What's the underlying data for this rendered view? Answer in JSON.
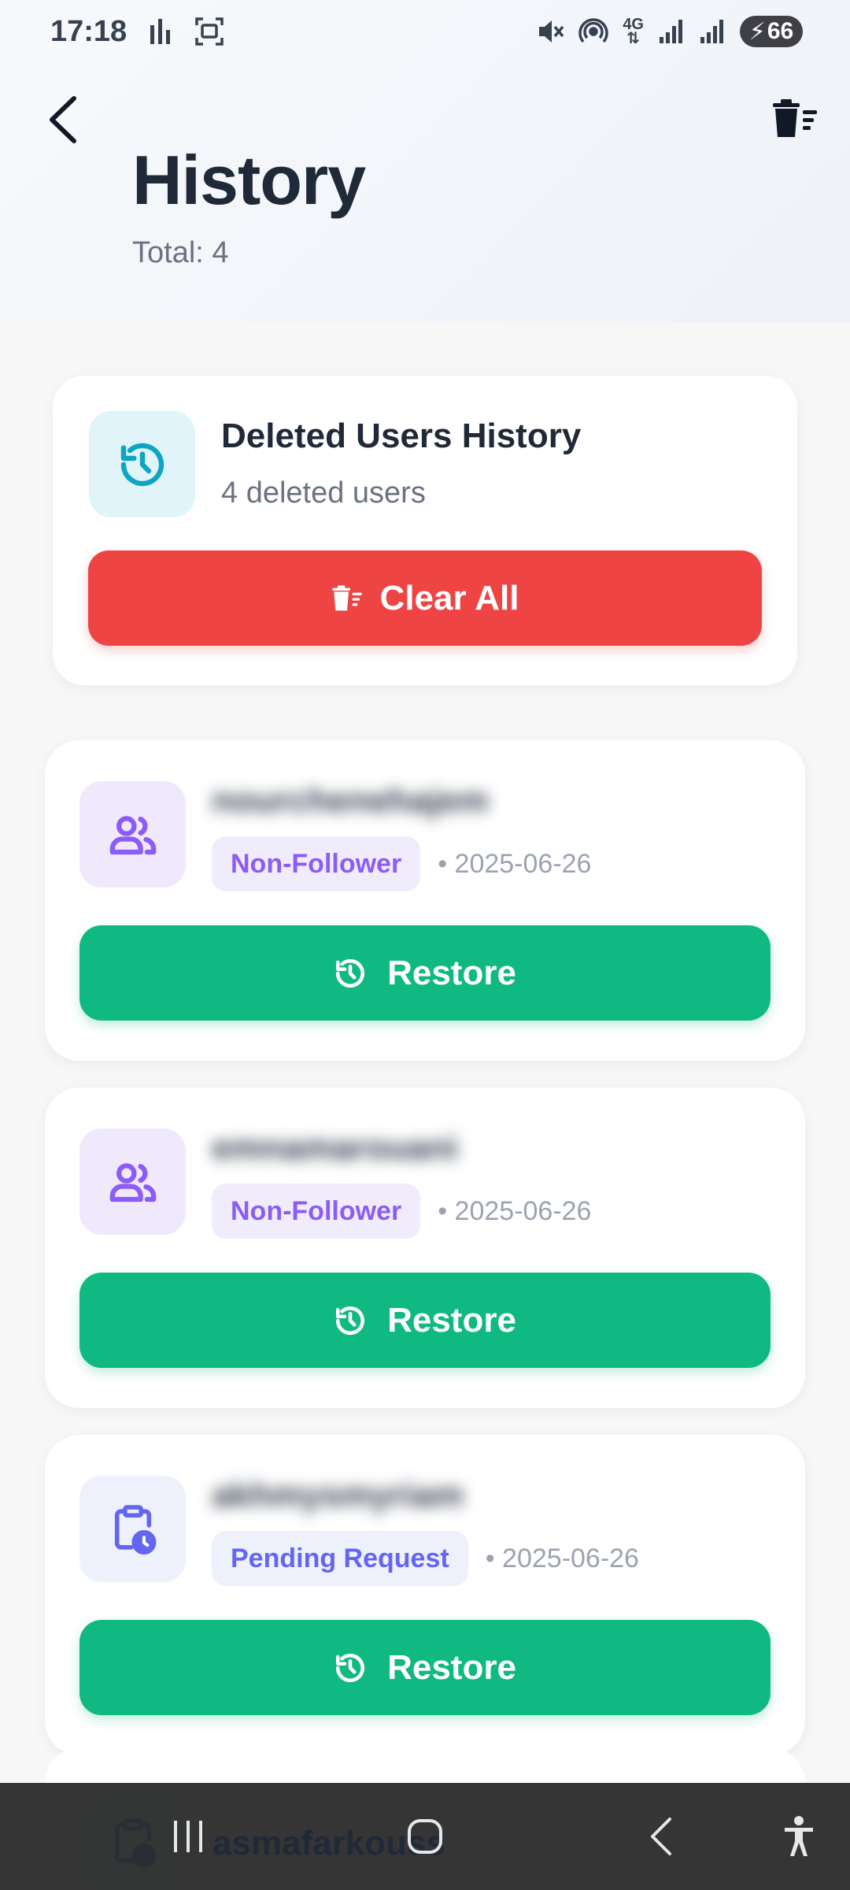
{
  "status_bar": {
    "time": "17:18",
    "battery": "66"
  },
  "header": {
    "title": "History",
    "subtitle": "Total: 4"
  },
  "summary": {
    "title": "Deleted Users History",
    "count_text": "4 deleted users",
    "clear_all_label": "Clear All"
  },
  "cards": [
    {
      "username": "nourchenehajem",
      "badge": "Non-Follower",
      "date": "• 2025-06-26",
      "restore_label": "Restore",
      "icon": "users-icon"
    },
    {
      "username": "emnamarouani",
      "badge": "Non-Follower",
      "date": "• 2025-06-26",
      "restore_label": "Restore",
      "icon": "users-icon"
    },
    {
      "username": "akhmysmyriam",
      "badge": "Pending Request",
      "date": "• 2025-06-26",
      "restore_label": "Restore",
      "icon": "clipboard-clock-icon"
    }
  ],
  "peek_card": {
    "username": "asmafarkouss"
  },
  "colors": {
    "danger": "#ef4444",
    "success": "#10b981",
    "purple": "#8b5cf6",
    "indigo": "#6366f1",
    "teal": "#0ea5c0"
  }
}
